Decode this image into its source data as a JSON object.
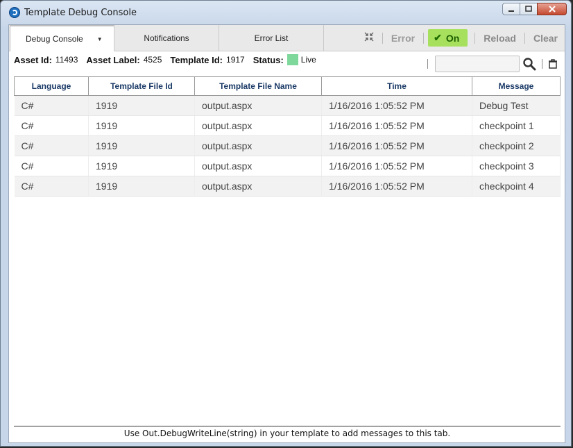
{
  "window": {
    "title": "Template Debug Console"
  },
  "tabs": [
    {
      "label": "Debug Console"
    },
    {
      "label": "Notifications"
    },
    {
      "label": "Error List"
    }
  ],
  "toolbar": {
    "error_label": "Error",
    "on_label": "On",
    "reload_label": "Reload",
    "clear_label": "Clear"
  },
  "info": {
    "asset_id_label": "Asset Id:",
    "asset_id": "11493",
    "asset_label_label": "Asset Label:",
    "asset_label": "4525",
    "template_id_label": "Template Id:",
    "template_id": "1917",
    "status_label": "Status:",
    "status": "Live",
    "status_color": "#7ed89c"
  },
  "table": {
    "headers": [
      "Language",
      "Template File Id",
      "Template File Name",
      "Time",
      "Message"
    ],
    "rows": [
      [
        "C#",
        "1919",
        "output.aspx",
        "1/16/2016 1:05:52 PM",
        "Debug Test"
      ],
      [
        "C#",
        "1919",
        "output.aspx",
        "1/16/2016 1:05:52 PM",
        "checkpoint 1"
      ],
      [
        "C#",
        "1919",
        "output.aspx",
        "1/16/2016 1:05:52 PM",
        "checkpoint 2"
      ],
      [
        "C#",
        "1919",
        "output.aspx",
        "1/16/2016 1:05:52 PM",
        "checkpoint 3"
      ],
      [
        "C#",
        "1919",
        "output.aspx",
        "1/16/2016 1:05:52 PM",
        "checkpoint 4"
      ]
    ]
  },
  "footer": {
    "text": "Use Out.DebugWriteLine(string) in your template to add messages to this tab."
  },
  "colors": {
    "on_bg": "#a6e05c",
    "header_text": "#1a3a66"
  }
}
